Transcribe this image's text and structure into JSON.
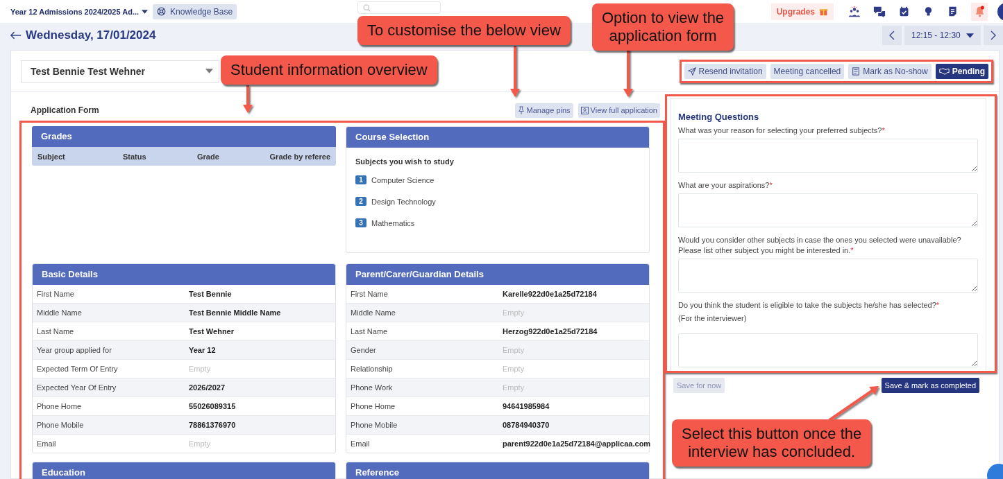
{
  "top_bar": {
    "programme": "Year 12 Admissions 2024/2025 Ad...",
    "knowledge_base": "Knowledge Base",
    "upgrades": "Upgrades",
    "notifications_unread": true
  },
  "date_header": {
    "title": "Wednesday, 17/01/2024",
    "time_slot": "12:15 - 12:30"
  },
  "student_select": {
    "value": "Test Bennie Test Wehner"
  },
  "actions": [
    {
      "label": "Resend invitation",
      "kind": "send",
      "primary": false
    },
    {
      "label": "Meeting cancelled",
      "kind": "plain",
      "primary": false
    },
    {
      "label": "Mark as No-show",
      "kind": "note",
      "primary": false
    },
    {
      "label": "Pending",
      "kind": "handshake",
      "primary": true
    }
  ],
  "application_form": {
    "title": "Application Form",
    "buttons": [
      {
        "label": "Manage pins",
        "kind": "pin"
      },
      {
        "label": "View full application",
        "kind": "person"
      }
    ],
    "panels": [
      {
        "kind": "table",
        "title": "Grades",
        "columns": [
          "Subject",
          "Status",
          "Grade",
          "Grade by referee"
        ]
      },
      {
        "kind": "list",
        "title": "Course Selection",
        "subtitle": "Subjects you wish to study",
        "items": [
          {
            "number": "1",
            "label": "Computer Science"
          },
          {
            "number": "2",
            "label": "Design Technology"
          },
          {
            "number": "3",
            "label": "Mathematics"
          }
        ]
      },
      {
        "kind": "details",
        "title": "Basic Details",
        "rows": [
          {
            "label": "First Name",
            "value": "Test Bennie",
            "empty": false
          },
          {
            "label": "Middle Name",
            "value": "Test Bennie Middle Name",
            "empty": false
          },
          {
            "label": "Last Name",
            "value": "Test Wehner",
            "empty": false
          },
          {
            "label": "Year group applied for",
            "value": "Year 12",
            "empty": false
          },
          {
            "label": "Expected Term Of Entry",
            "value": "Empty",
            "empty": true
          },
          {
            "label": "Expected Year Of Entry",
            "value": "2026/2027",
            "empty": false
          },
          {
            "label": "Phone Home",
            "value": "55026089315",
            "empty": false
          },
          {
            "label": "Phone Mobile",
            "value": "78861376970",
            "empty": false
          },
          {
            "label": "Email",
            "value": "Empty",
            "empty": true
          }
        ]
      },
      {
        "kind": "details",
        "title": "Parent/Carer/Guardian Details",
        "rows": [
          {
            "label": "First Name",
            "value": "Karelle922d0e1a25d72184",
            "empty": false
          },
          {
            "label": "Middle Name",
            "value": "Empty",
            "empty": true
          },
          {
            "label": "Last Name",
            "value": "Herzog922d0e1a25d72184",
            "empty": false
          },
          {
            "label": "Gender",
            "value": "Empty",
            "empty": true
          },
          {
            "label": "Relationship",
            "value": "Empty",
            "empty": true
          },
          {
            "label": "Phone Work",
            "value": "Empty",
            "empty": true
          },
          {
            "label": "Phone Home",
            "value": "94641985984",
            "empty": false
          },
          {
            "label": "Phone Mobile",
            "value": "08784940370",
            "empty": false
          },
          {
            "label": "Email",
            "value": "parent922d0e1a25d72184@applicaa.com",
            "empty": false
          }
        ]
      },
      {
        "kind": "header",
        "title": "Education"
      },
      {
        "kind": "header",
        "title": "Reference"
      }
    ]
  },
  "meeting_questions": {
    "title": "Meeting Questions",
    "questions": [
      {
        "lines": [
          "What was your reason for selecting your preferred subjects?"
        ],
        "required_mark": "*"
      },
      {
        "lines": [
          "What are your aspirations?"
        ],
        "required_mark": "*"
      },
      {
        "lines": [
          "Would you consider other subjects in case the ones you selected were unavailable?",
          "Please list other subject you might be interested in."
        ],
        "required_mark": "*"
      },
      {
        "lines": [
          "Do you think the student is eligible to take the subjects he/she has selected?"
        ],
        "required_mark": "*",
        "note": "(For the interviewer)"
      }
    ],
    "save_later": "Save for now",
    "complete": "Save & mark as completed"
  },
  "callouts": [
    {
      "lines": [
        "To customise the below view"
      ]
    },
    {
      "lines": [
        "Option to view the",
        "application form"
      ]
    },
    {
      "lines": [
        "Student information overview"
      ]
    },
    {
      "lines": [
        "Select this button once the",
        "interview has concluded."
      ]
    }
  ]
}
